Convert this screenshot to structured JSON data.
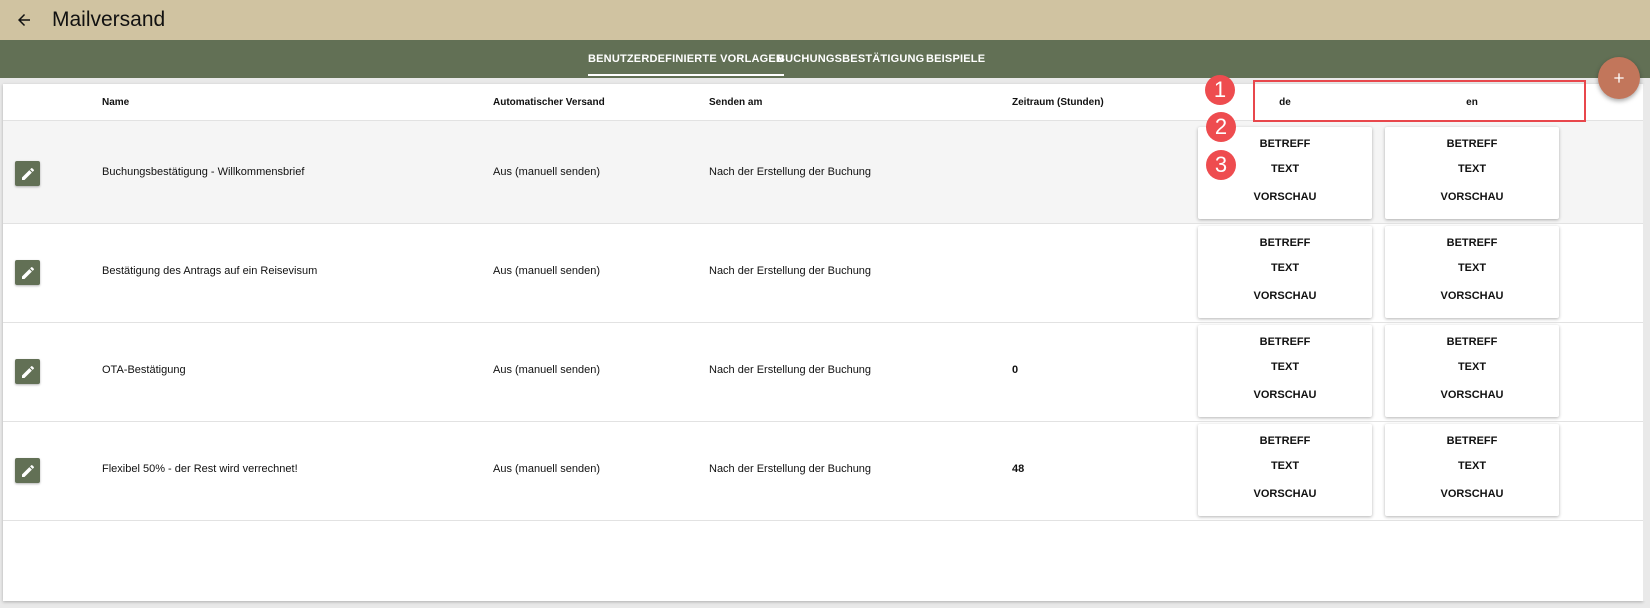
{
  "app": {
    "title": "Mailversand"
  },
  "tabs": [
    {
      "label": "BENUTZERDEFINIERTE VORLAGEN",
      "active": true
    },
    {
      "label": "BUCHUNGSBESTÄTIGUNG",
      "active": false
    },
    {
      "label": "BEISPIELE",
      "active": false
    }
  ],
  "table": {
    "headers": {
      "name": "Name",
      "auto": "Automatischer Versand",
      "send_on": "Senden am",
      "period": "Zeitraum (Stunden)",
      "lang_de": "de",
      "lang_en": "en"
    },
    "lang_buttons": {
      "subject": "BETREFF",
      "text": "TEXT",
      "preview": "VORSCHAU"
    },
    "rows": [
      {
        "name": "Buchungsbestätigung - Willkommensbrief",
        "auto": "Aus (manuell senden)",
        "send_on": "Nach der Erstellung der Buchung",
        "period": ""
      },
      {
        "name": "Bestätigung des Antrags auf ein Reisevisum",
        "auto": "Aus (manuell senden)",
        "send_on": "Nach der Erstellung der Buchung",
        "period": ""
      },
      {
        "name": "OTA-Bestätigung",
        "auto": "Aus (manuell senden)",
        "send_on": "Nach der Erstellung der Buchung",
        "period": "0"
      },
      {
        "name": "Flexibel 50% - der Rest wird verrechnet!",
        "auto": "Aus (manuell senden)",
        "send_on": "Nach der Erstellung der Buchung",
        "period": "48"
      }
    ]
  },
  "annotations": {
    "m1": "1",
    "m2": "2",
    "m3": "3"
  },
  "colors": {
    "topbar": "#d0c3a1",
    "tabbar": "#627055",
    "fab": "#c2765b",
    "highlight": "#e8474c"
  },
  "icons": {
    "back": "arrow-left-icon",
    "add": "plus-icon",
    "edit": "pencil-icon"
  }
}
